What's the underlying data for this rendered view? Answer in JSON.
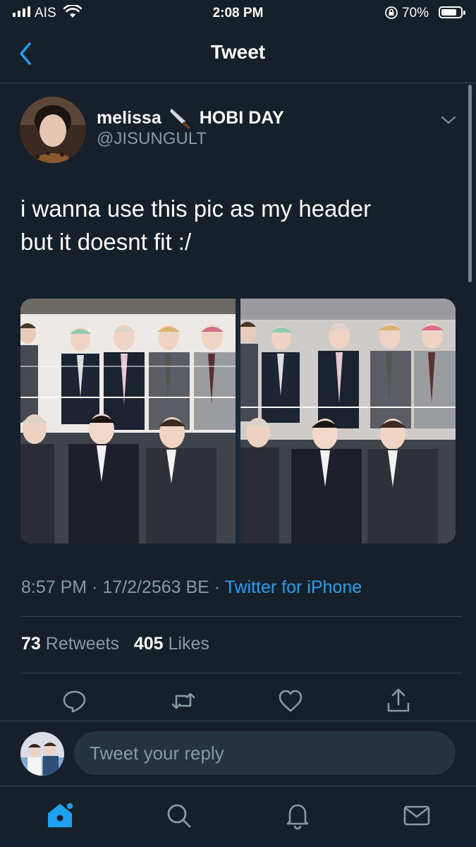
{
  "status_bar": {
    "carrier": "AIS",
    "time": "2:08 PM",
    "battery": "70%",
    "battery_level": 0.7
  },
  "nav": {
    "title": "Tweet",
    "back_icon": "chevron-left-icon"
  },
  "tweet": {
    "display_name": "melissa",
    "display_name_emoji": "knife-icon",
    "display_name_suffix": "HOBI DAY",
    "username": "@JISUNGULT",
    "text_line1": "i wanna use this pic as my header",
    "text_line2": "but it doesnt fit :/",
    "timestamp": "8:57 PM · 17/2/2563 BE · ",
    "source": "Twitter for iPhone",
    "retweets_count": "73",
    "retweets_label": " Retweets",
    "likes_count": "405",
    "likes_label": " Likes"
  },
  "actions": [
    "reply-icon",
    "retweet-icon",
    "like-icon",
    "share-icon"
  ],
  "reply": {
    "placeholder": "Tweet your reply"
  },
  "tabs": [
    "home-icon",
    "search-icon",
    "notifications-icon",
    "messages-icon"
  ],
  "colors": {
    "background": "#15202b",
    "accent": "#1da1f2",
    "secondary_text": "#8899a6",
    "divider": "#38444d"
  }
}
